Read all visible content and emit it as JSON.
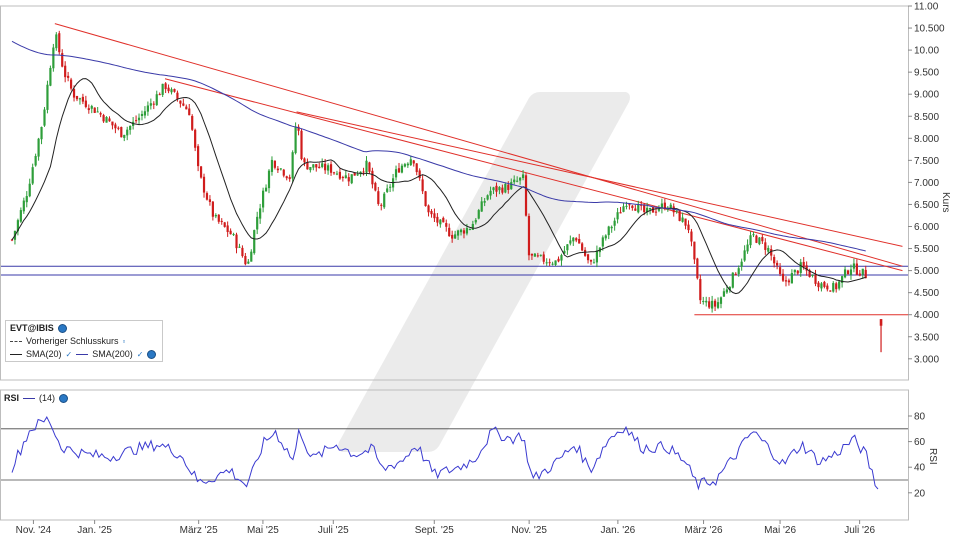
{
  "colors": {
    "up_candle": "#2e9e3a",
    "down_candle": "#d01c1c",
    "sma20": "#222222",
    "sma200": "#3a3aa8",
    "trendline": "#e0302a",
    "support": "#3a3aa8",
    "rsi": "#3a3ad0",
    "watermark": "#e6e6e6"
  },
  "legend": {
    "symbol": "EVT@IBIS",
    "prev_close": "Vorheriger Schlusskurs",
    "sma20": "SMA(20)",
    "sma200": "SMA(200)"
  },
  "rsi_legend": {
    "title": "RSI",
    "period": "(14)"
  },
  "chart_data": [
    {
      "type": "candlestick",
      "ylabel": "Kurs",
      "ylim": [
        2.8,
        11.1
      ],
      "yticks": [
        "11.00",
        "10.500",
        "10.00",
        "9.500",
        "9.000",
        "8.500",
        "8.000",
        "7.500",
        "7.000",
        "6.500",
        "6.000",
        "5.500",
        "5.000",
        "4.500",
        "4.000",
        "3.500",
        "3.000"
      ],
      "x_ticks": [
        "Nov. '24",
        "Jan. '25",
        "März '25",
        "Mai '25",
        "Juli '25",
        "Sept. '25",
        "Nov. '25",
        "Jan. '26",
        "März '26",
        "Mai '26",
        "Juli '26"
      ],
      "close_keypoints": [
        {
          "m": 0.0,
          "v": 5.7
        },
        {
          "m": 0.25,
          "v": 6.8
        },
        {
          "m": 0.5,
          "v": 8.4
        },
        {
          "m": 0.7,
          "v": 10.4
        },
        {
          "m": 0.85,
          "v": 9.5
        },
        {
          "m": 1.0,
          "v": 9.0
        },
        {
          "m": 1.4,
          "v": 8.6
        },
        {
          "m": 1.8,
          "v": 8.1
        },
        {
          "m": 2.1,
          "v": 8.5
        },
        {
          "m": 2.5,
          "v": 9.2
        },
        {
          "m": 2.9,
          "v": 8.6
        },
        {
          "m": 3.05,
          "v": 7.2
        },
        {
          "m": 3.3,
          "v": 6.2
        },
        {
          "m": 3.6,
          "v": 5.8
        },
        {
          "m": 3.85,
          "v": 5.1
        },
        {
          "m": 4.0,
          "v": 6.2
        },
        {
          "m": 4.25,
          "v": 7.5
        },
        {
          "m": 4.55,
          "v": 7.1
        },
        {
          "m": 4.65,
          "v": 8.5
        },
        {
          "m": 4.75,
          "v": 7.4
        },
        {
          "m": 5.2,
          "v": 7.3
        },
        {
          "m": 5.5,
          "v": 7.1
        },
        {
          "m": 5.8,
          "v": 7.4
        },
        {
          "m": 6.0,
          "v": 6.4
        },
        {
          "m": 6.3,
          "v": 7.3
        },
        {
          "m": 6.55,
          "v": 7.6
        },
        {
          "m": 6.8,
          "v": 6.3
        },
        {
          "m": 7.2,
          "v": 5.8
        },
        {
          "m": 7.5,
          "v": 6.0
        },
        {
          "m": 7.8,
          "v": 6.8
        },
        {
          "m": 8.1,
          "v": 6.9
        },
        {
          "m": 8.35,
          "v": 7.1
        },
        {
          "m": 8.45,
          "v": 5.3
        },
        {
          "m": 8.9,
          "v": 5.2
        },
        {
          "m": 9.2,
          "v": 5.8
        },
        {
          "m": 9.45,
          "v": 5.1
        },
        {
          "m": 9.7,
          "v": 5.8
        },
        {
          "m": 10.05,
          "v": 6.6
        },
        {
          "m": 10.35,
          "v": 6.3
        },
        {
          "m": 10.7,
          "v": 6.5
        },
        {
          "m": 11.05,
          "v": 6.0
        },
        {
          "m": 11.25,
          "v": 4.3
        },
        {
          "m": 11.5,
          "v": 4.2
        },
        {
          "m": 11.8,
          "v": 4.9
        },
        {
          "m": 12.1,
          "v": 5.8
        },
        {
          "m": 12.35,
          "v": 5.5
        },
        {
          "m": 12.6,
          "v": 4.7
        },
        {
          "m": 12.9,
          "v": 5.1
        },
        {
          "m": 13.2,
          "v": 4.7
        },
        {
          "m": 13.45,
          "v": 4.6
        },
        {
          "m": 13.7,
          "v": 5.1
        },
        {
          "m": 13.95,
          "v": 4.9
        }
      ],
      "final_candle": {
        "open": 3.9,
        "high": 3.9,
        "low": 3.15,
        "close": 3.75
      },
      "trendlines": [
        {
          "from": {
            "m": 0.7,
            "v": 10.6
          },
          "to": {
            "m": 14.55,
            "v": 5.1
          }
        },
        {
          "from": {
            "m": 2.5,
            "v": 9.35
          },
          "to": {
            "m": 14.55,
            "v": 5.0
          }
        },
        {
          "from": {
            "m": 4.65,
            "v": 8.6
          },
          "to": {
            "m": 14.55,
            "v": 5.55
          }
        }
      ],
      "horizontal_lines": [
        {
          "value": 5.1,
          "color": "support"
        },
        {
          "value": 4.9,
          "color": "support"
        },
        {
          "value": 4.0,
          "from_m": 11.15,
          "color": "trendline"
        }
      ]
    },
    {
      "type": "line",
      "title": "RSI",
      "ylim": [
        12,
        88
      ],
      "yticks": [
        80,
        60,
        40,
        20
      ],
      "ylabel": "RSI",
      "reference_lines": [
        70,
        30
      ],
      "rsi_keypoints": [
        {
          "m": 0.0,
          "v": 40
        },
        {
          "m": 0.3,
          "v": 70
        },
        {
          "m": 0.6,
          "v": 78
        },
        {
          "m": 0.8,
          "v": 56
        },
        {
          "m": 1.2,
          "v": 50
        },
        {
          "m": 1.6,
          "v": 48
        },
        {
          "m": 2.0,
          "v": 54
        },
        {
          "m": 2.4,
          "v": 58
        },
        {
          "m": 2.75,
          "v": 50
        },
        {
          "m": 3.05,
          "v": 28
        },
        {
          "m": 3.3,
          "v": 32
        },
        {
          "m": 3.55,
          "v": 38
        },
        {
          "m": 3.85,
          "v": 25
        },
        {
          "m": 4.1,
          "v": 58
        },
        {
          "m": 4.3,
          "v": 68
        },
        {
          "m": 4.6,
          "v": 45
        },
        {
          "m": 4.7,
          "v": 70
        },
        {
          "m": 4.9,
          "v": 46
        },
        {
          "m": 5.3,
          "v": 58
        },
        {
          "m": 5.6,
          "v": 50
        },
        {
          "m": 5.9,
          "v": 54
        },
        {
          "m": 6.05,
          "v": 38
        },
        {
          "m": 6.4,
          "v": 46
        },
        {
          "m": 6.6,
          "v": 58
        },
        {
          "m": 6.9,
          "v": 34
        },
        {
          "m": 7.3,
          "v": 40
        },
        {
          "m": 7.55,
          "v": 46
        },
        {
          "m": 7.85,
          "v": 68
        },
        {
          "m": 8.15,
          "v": 62
        },
        {
          "m": 8.35,
          "v": 65
        },
        {
          "m": 8.5,
          "v": 30
        },
        {
          "m": 8.9,
          "v": 44
        },
        {
          "m": 9.2,
          "v": 58
        },
        {
          "m": 9.45,
          "v": 38
        },
        {
          "m": 9.75,
          "v": 62
        },
        {
          "m": 10.0,
          "v": 72
        },
        {
          "m": 10.3,
          "v": 55
        },
        {
          "m": 10.7,
          "v": 56
        },
        {
          "m": 11.0,
          "v": 44
        },
        {
          "m": 11.2,
          "v": 26
        },
        {
          "m": 11.5,
          "v": 30
        },
        {
          "m": 11.8,
          "v": 48
        },
        {
          "m": 12.1,
          "v": 68
        },
        {
          "m": 12.35,
          "v": 56
        },
        {
          "m": 12.6,
          "v": 42
        },
        {
          "m": 12.9,
          "v": 58
        },
        {
          "m": 13.2,
          "v": 44
        },
        {
          "m": 13.45,
          "v": 50
        },
        {
          "m": 13.75,
          "v": 62
        },
        {
          "m": 13.95,
          "v": 50
        },
        {
          "m": 14.15,
          "v": 22
        }
      ]
    }
  ]
}
